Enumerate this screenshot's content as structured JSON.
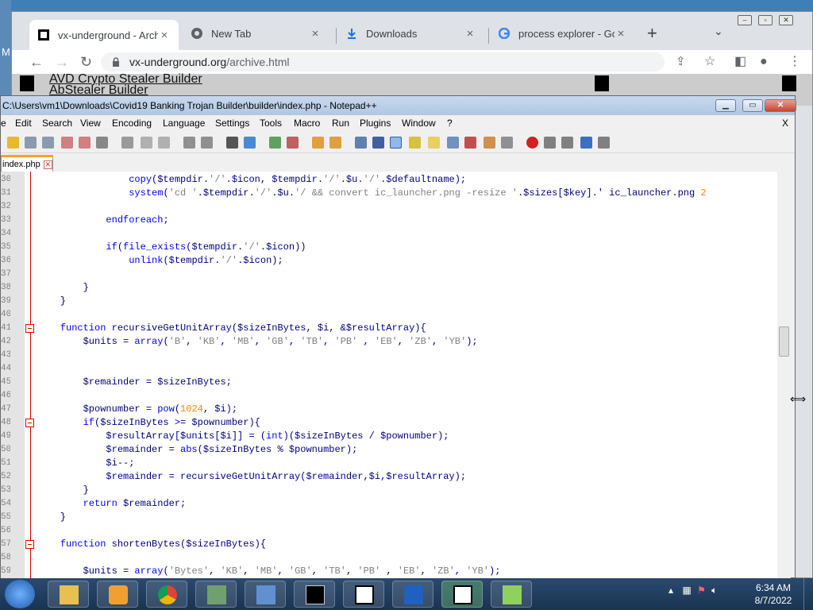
{
  "desktop": {
    "partial_label": "M"
  },
  "browser": {
    "tabs": [
      {
        "label": "vx-underground - Archi",
        "active": true,
        "icon": "vx-underground-favicon"
      },
      {
        "label": "New Tab",
        "active": false,
        "icon": "chrome-icon"
      },
      {
        "label": "Downloads",
        "active": false,
        "icon": "download-icon"
      },
      {
        "label": "process explorer - Goog",
        "active": false,
        "icon": "google-icon"
      }
    ],
    "close_glyph": "×",
    "new_tab_glyph": "+",
    "tab_search_glyph": "⌄",
    "address": {
      "domain": "vx-underground.org",
      "path": "/archive.html"
    },
    "page": {
      "links": [
        "AVD Crypto Stealer Builder",
        "AbStealer Builder"
      ]
    }
  },
  "notepadpp": {
    "title": "C:\\Users\\vm1\\Downloads\\Covid19 Banking Trojan Builder\\builder\\index.php - Notepad++",
    "menu": [
      "e",
      "Edit",
      "Search",
      "View",
      "Encoding",
      "Language",
      "Settings",
      "Tools",
      "Macro",
      "Run",
      "Plugins",
      "Window",
      "?"
    ],
    "menu_close": "X",
    "file_tab": "index.php",
    "lines": [
      {
        "num": "30",
        "fold": false,
        "text": "                copy($tempdir.'/'.$icon, $tempdir.'/'.$u.'/'.$defaultname);"
      },
      {
        "num": "31",
        "fold": false,
        "text": "                system('cd '.$tempdir.'/'.$u.'/ && convert ic_launcher.png -resize '.$sizes[$key].' ic_launcher.png 2"
      },
      {
        "num": "32",
        "fold": false,
        "text": ""
      },
      {
        "num": "33",
        "fold": false,
        "text": "            endforeach;"
      },
      {
        "num": "34",
        "fold": false,
        "text": ""
      },
      {
        "num": "35",
        "fold": false,
        "text": "            if(file_exists($tempdir.'/'.$icon))"
      },
      {
        "num": "36",
        "fold": false,
        "text": "                unlink($tempdir.'/'.$icon);"
      },
      {
        "num": "37",
        "fold": false,
        "text": ""
      },
      {
        "num": "38",
        "fold": false,
        "text": "        }"
      },
      {
        "num": "39",
        "fold": false,
        "text": "    }"
      },
      {
        "num": "40",
        "fold": false,
        "text": ""
      },
      {
        "num": "41",
        "fold": true,
        "text": "    function recursiveGetUnitArray($sizeInBytes, $i, &$resultArray){"
      },
      {
        "num": "42",
        "fold": false,
        "text": "        $units = array('B', 'KB', 'MB', 'GB', 'TB', 'PB' , 'EB', 'ZB', 'YB');"
      },
      {
        "num": "43",
        "fold": false,
        "text": ""
      },
      {
        "num": "44",
        "fold": false,
        "text": ""
      },
      {
        "num": "45",
        "fold": false,
        "text": "        $remainder = $sizeInBytes;"
      },
      {
        "num": "46",
        "fold": false,
        "text": ""
      },
      {
        "num": "47",
        "fold": false,
        "text": "        $pownumber = pow(1024, $i);"
      },
      {
        "num": "48",
        "fold": true,
        "text": "        if($sizeInBytes >= $pownumber){"
      },
      {
        "num": "49",
        "fold": false,
        "text": "            $resultArray[$units[$i]] = (int)($sizeInBytes / $pownumber);"
      },
      {
        "num": "50",
        "fold": false,
        "text": "            $remainder = abs($sizeInBytes % $pownumber);"
      },
      {
        "num": "51",
        "fold": false,
        "text": "            $i--;"
      },
      {
        "num": "52",
        "fold": false,
        "text": "            $remainder = recursiveGetUnitArray($remainder,$i,$resultArray);"
      },
      {
        "num": "53",
        "fold": false,
        "text": "        }"
      },
      {
        "num": "54",
        "fold": false,
        "text": "        return $remainder;"
      },
      {
        "num": "55",
        "fold": false,
        "text": "    }"
      },
      {
        "num": "56",
        "fold": false,
        "text": ""
      },
      {
        "num": "57",
        "fold": true,
        "text": "    function shortenBytes($sizeInBytes){"
      },
      {
        "num": "58",
        "fold": false,
        "text": ""
      },
      {
        "num": "59",
        "fold": false,
        "text": "        $units = array('Bytes', 'KB', 'MB', 'GB', 'TB', 'PB' , 'EB', 'ZB', 'YB');"
      }
    ]
  },
  "taskbar": {
    "apps": [
      "file-explorer",
      "media-player",
      "chrome",
      "system-monitor",
      "control-panel",
      "command-prompt",
      "7zip",
      "malwarebytes",
      "7zip-active",
      "notepad-plus-plus"
    ],
    "clock": {
      "time": "6:34 AM",
      "date": "8/7/2022"
    }
  },
  "colors": {
    "keyword": "#0000ff",
    "text": "#000080",
    "string": "#808080",
    "number": "#ff8000",
    "fold": "#e00000"
  }
}
